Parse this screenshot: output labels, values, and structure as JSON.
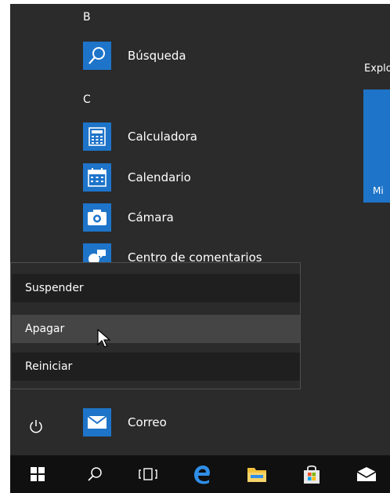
{
  "start_menu": {
    "groups": [
      {
        "letter": "B",
        "apps": [
          {
            "label": "Búsqueda",
            "icon": "search-icon"
          }
        ]
      },
      {
        "letter": "C",
        "apps": [
          {
            "label": "Calculadora",
            "icon": "calculator-icon"
          },
          {
            "label": "Calendario",
            "icon": "calendar-icon"
          },
          {
            "label": "Cámara",
            "icon": "camera-icon"
          },
          {
            "label": "Centro de comentarios",
            "icon": "feedback-hub-icon"
          },
          {
            "label": "Correo",
            "icon": "mail-icon"
          }
        ]
      }
    ],
    "tiles_header": "Explo",
    "tile_label": "Mi"
  },
  "power_menu": {
    "items": [
      {
        "label": "Suspender"
      },
      {
        "label": "Apagar",
        "hovered": true
      },
      {
        "label": "Reiniciar"
      }
    ]
  },
  "taskbar": {
    "items": [
      "windows-start-icon",
      "search-icon",
      "task-view-icon",
      "edge-icon",
      "file-explorer-icon",
      "store-icon",
      "mail-icon"
    ]
  },
  "colors": {
    "menu_bg": "#2b2b2b",
    "accent": "#1e74c9",
    "taskbar": "#101010",
    "hover": "#454545",
    "edge": "#2f8fe8",
    "folder": "#f3c23b"
  }
}
